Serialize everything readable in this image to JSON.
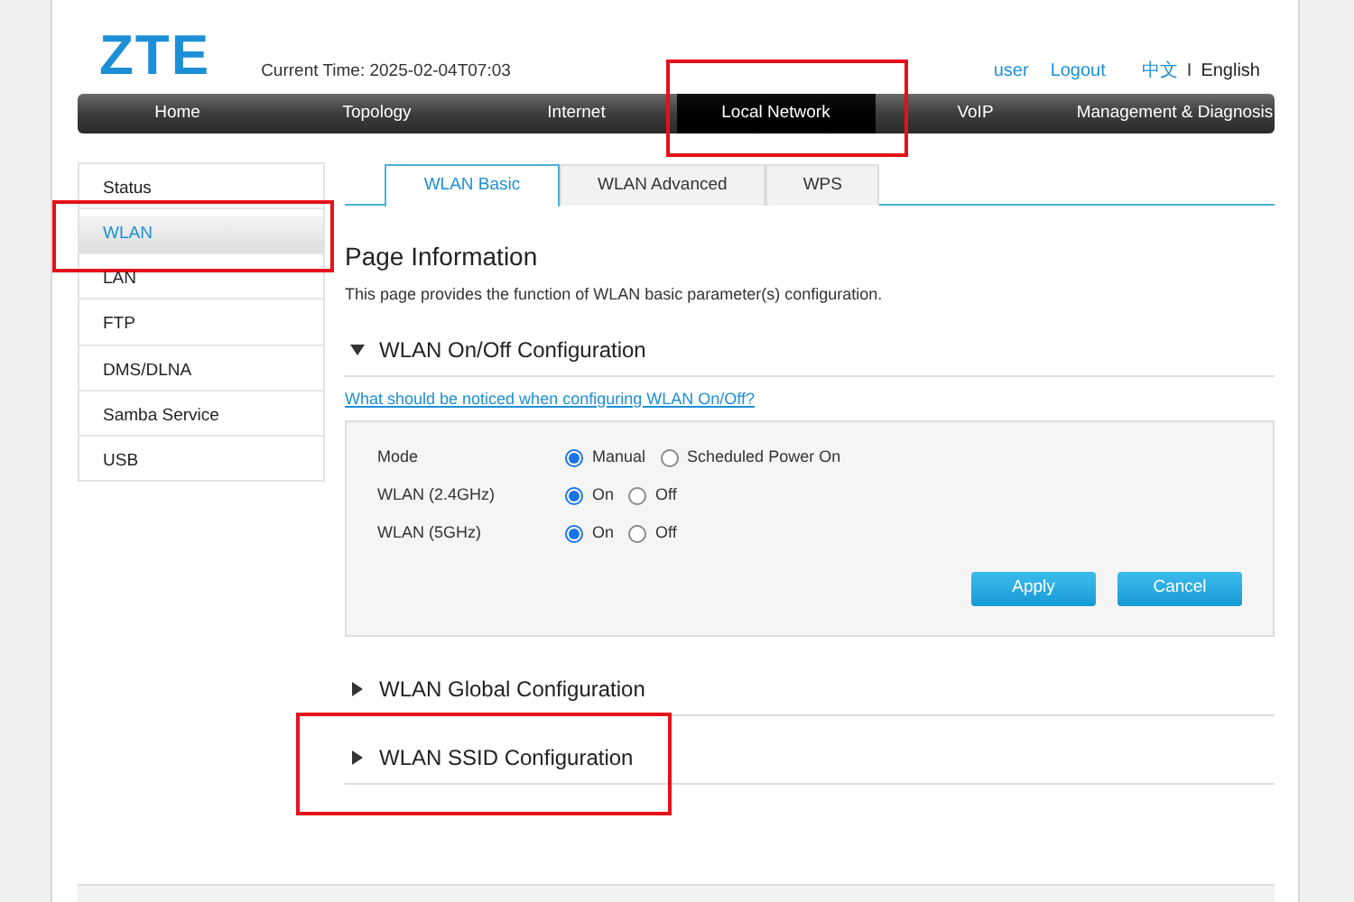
{
  "logo": "ZTE",
  "current_time": "Current Time: 2025-02-04T07:03",
  "user_links": [
    {
      "label": "user"
    },
    {
      "label": "Logout"
    }
  ],
  "languages": [
    {
      "label": "中文",
      "selected": false
    },
    {
      "label": "English",
      "selected": true
    }
  ],
  "language_separator": "I",
  "nav": [
    {
      "label": "Home",
      "selected": false,
      "highlighted": false
    },
    {
      "label": "Topology",
      "selected": false,
      "highlighted": false
    },
    {
      "label": "Internet",
      "selected": false,
      "highlighted": false
    },
    {
      "label": "Local Network",
      "selected": true,
      "highlighted": true
    },
    {
      "label": "VoIP",
      "selected": false,
      "highlighted": false
    },
    {
      "label": "Management & Diagnosis",
      "selected": false,
      "highlighted": false
    }
  ],
  "sidebar": [
    {
      "label": "Status",
      "selected": false,
      "highlighted": false
    },
    {
      "label": "WLAN",
      "selected": true,
      "highlighted": true
    },
    {
      "label": "LAN",
      "selected": false,
      "highlighted": false
    },
    {
      "label": "FTP",
      "selected": false,
      "highlighted": false
    },
    {
      "label": "DMS/DLNA",
      "selected": false,
      "highlighted": false
    },
    {
      "label": "Samba Service",
      "selected": false,
      "highlighted": false
    },
    {
      "label": "USB",
      "selected": false,
      "highlighted": false
    }
  ],
  "tabs": [
    {
      "label": "WLAN Basic",
      "selected": true
    },
    {
      "label": "WLAN Advanced",
      "selected": false
    },
    {
      "label": "WPS",
      "selected": false
    }
  ],
  "page_title": "Page Information",
  "description": "This page provides the function of WLAN basic parameter(s) configuration.",
  "sections": [
    {
      "title": "WLAN On/Off Configuration",
      "expanded": true,
      "highlighted": false,
      "help_link": "What should be noticed when configuring WLAN On/Off?",
      "fields": [
        {
          "label": "Mode",
          "options": [
            {
              "label": "Manual",
              "selected": true
            },
            {
              "label": "Scheduled Power On",
              "selected": false
            }
          ]
        },
        {
          "label": "WLAN (2.4GHz)",
          "options": [
            {
              "label": "On",
              "selected": true
            },
            {
              "label": "Off",
              "selected": false
            }
          ]
        },
        {
          "label": "WLAN (5GHz)",
          "options": [
            {
              "label": "On",
              "selected": true
            },
            {
              "label": "Off",
              "selected": false
            }
          ]
        }
      ],
      "buttons": [
        "Apply",
        "Cancel"
      ]
    },
    {
      "title": "WLAN Global Configuration",
      "expanded": false,
      "highlighted": false
    },
    {
      "title": "WLAN SSID Configuration",
      "expanded": false,
      "highlighted": true
    }
  ]
}
